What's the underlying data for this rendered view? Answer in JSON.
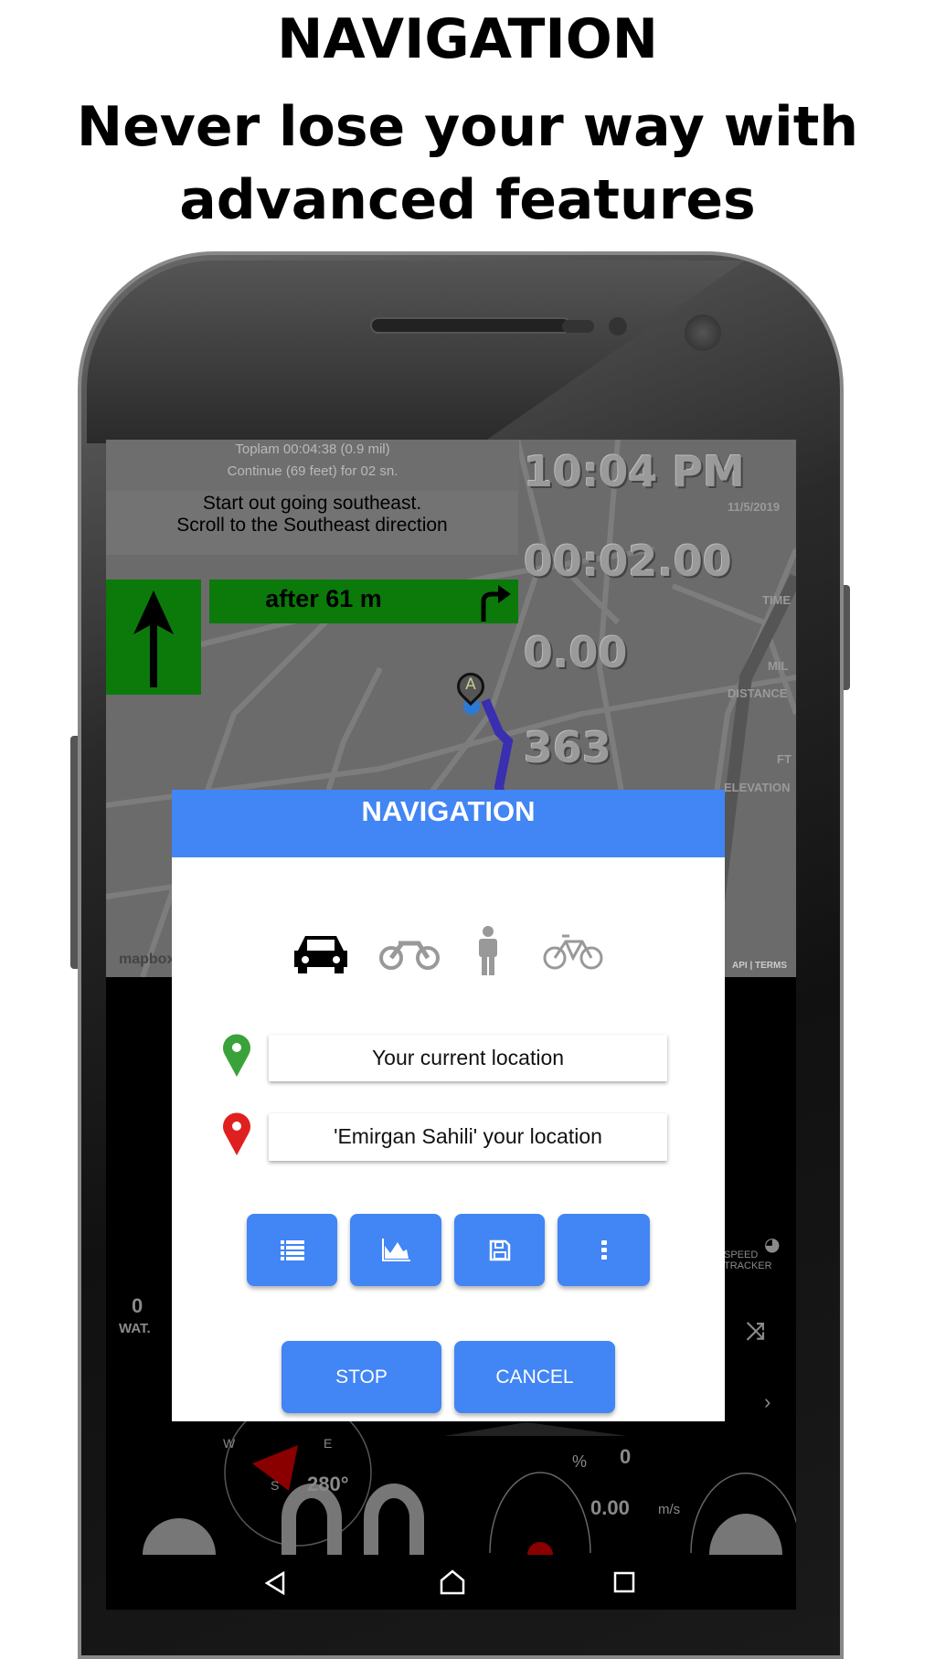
{
  "promo": {
    "title": "NAVIGATION",
    "subtitle_line1": "Never lose your way with",
    "subtitle_line2": "advanced features"
  },
  "map": {
    "summary": "Toplam 00:04:38 (0.9 mil)",
    "continue": "Continue (69 feet) for 02 sn.",
    "instruction_line1": "Start out going southeast.",
    "instruction_line2": "Scroll to the Southeast direction",
    "next_turn": "after 61 m",
    "marker_label": "A",
    "clock": "10:04 PM",
    "date": "11/5/2019",
    "elapsed": "00:02.00",
    "elapsed_label": "TIME",
    "distance": "0.00",
    "distance_unit": "MIL",
    "distance_label": "DISTANCE",
    "elevation": "363",
    "elevation_unit": "FT",
    "elevation_label": "ELEVATION",
    "attribution_left": "mapbox",
    "attribution_right": "API | TERMS",
    "route_color": "#3a2fb0",
    "sign_color": "#0b7a0b"
  },
  "dialog": {
    "title": "NAVIGATION",
    "modes": [
      {
        "icon": "car-icon",
        "selected": true
      },
      {
        "icon": "motorcycle-icon",
        "selected": false
      },
      {
        "icon": "walking-icon",
        "selected": false
      },
      {
        "icon": "bicycle-icon",
        "selected": false
      }
    ],
    "origin": "Your current location",
    "destination": "'Emirgan Sahili' your location",
    "actions": [
      {
        "icon": "list-icon"
      },
      {
        "icon": "area-chart-icon"
      },
      {
        "icon": "save-icon"
      },
      {
        "icon": "more-vertical-icon"
      }
    ],
    "stop": "STOP",
    "cancel": "CANCEL",
    "accent": "#4285f4"
  },
  "dashboard": {
    "wat_value": "0",
    "wat_label": "WAT.",
    "speed_tracker": "SPEED TRACKER",
    "heading": "280°",
    "compass_w": "W",
    "compass_e": "E",
    "compass_s": "S",
    "percent_symbol": "%",
    "percent_value": "0",
    "speed": "0.00",
    "speed_unit": "m/s"
  }
}
